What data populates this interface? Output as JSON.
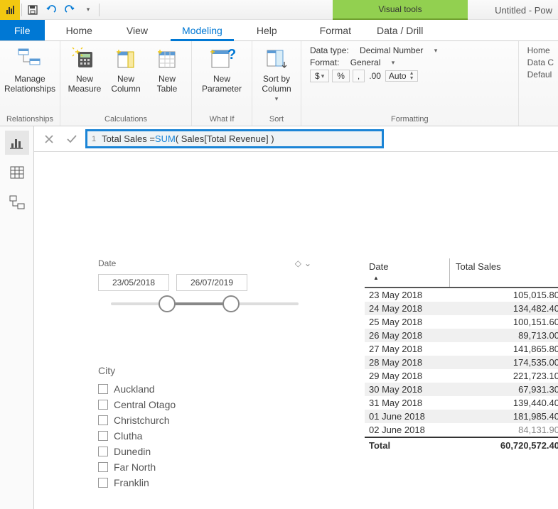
{
  "title": "Untitled - Pow",
  "contextual_tab": "Visual tools",
  "tabs": {
    "file": "File",
    "home": "Home",
    "view": "View",
    "modeling": "Modeling",
    "help": "Help",
    "format": "Format",
    "datadrill": "Data / Drill"
  },
  "ribbon": {
    "manage_rel": "Manage\nRelationships",
    "new_measure": "New\nMeasure",
    "new_column": "New\nColumn",
    "new_table": "New\nTable",
    "new_param": "New\nParameter",
    "sort_by": "Sort by\nColumn",
    "groups": {
      "relationships": "Relationships",
      "calculations": "Calculations",
      "whatif": "What If",
      "sort": "Sort",
      "formatting": "Formatting"
    },
    "fmt": {
      "datatype_label": "Data type:",
      "datatype_value": "Decimal Number",
      "format_label": "Format:",
      "format_value": "General",
      "currency": "$",
      "percent": "%",
      "thousand": ",",
      "decimals": ".00",
      "auto": "Auto"
    },
    "props": {
      "home": "Home",
      "datac": "Data C",
      "default": "Defaul"
    }
  },
  "formula": {
    "line": "1",
    "text_pre": "Total Sales = ",
    "fn": "SUM",
    "text_post": "( Sales[Total Revenue] )"
  },
  "slicers": {
    "date_label": "Date",
    "date_from": "23/05/2018",
    "date_to": "26/07/2019",
    "city_label": "City",
    "cities": [
      "Auckland",
      "Central Otago",
      "Christchurch",
      "Clutha",
      "Dunedin",
      "Far North",
      "Franklin"
    ]
  },
  "table": {
    "col1": "Date",
    "col2": "Total Sales",
    "rows": [
      {
        "d": "23 May 2018",
        "v": "105,015.80"
      },
      {
        "d": "24 May 2018",
        "v": "134,482.40"
      },
      {
        "d": "25 May 2018",
        "v": "100,151.60"
      },
      {
        "d": "26 May 2018",
        "v": "89,713.00"
      },
      {
        "d": "27 May 2018",
        "v": "141,865.80"
      },
      {
        "d": "28 May 2018",
        "v": "174,535.00"
      },
      {
        "d": "29 May 2018",
        "v": "221,723.10"
      },
      {
        "d": "30 May 2018",
        "v": "67,931.30"
      },
      {
        "d": "31 May 2018",
        "v": "139,440.40"
      },
      {
        "d": "01 June 2018",
        "v": "181,985.40"
      },
      {
        "d": "02 June 2018",
        "v": "84,131.90"
      }
    ],
    "total_label": "Total",
    "total_value": "60,720,572.40"
  }
}
